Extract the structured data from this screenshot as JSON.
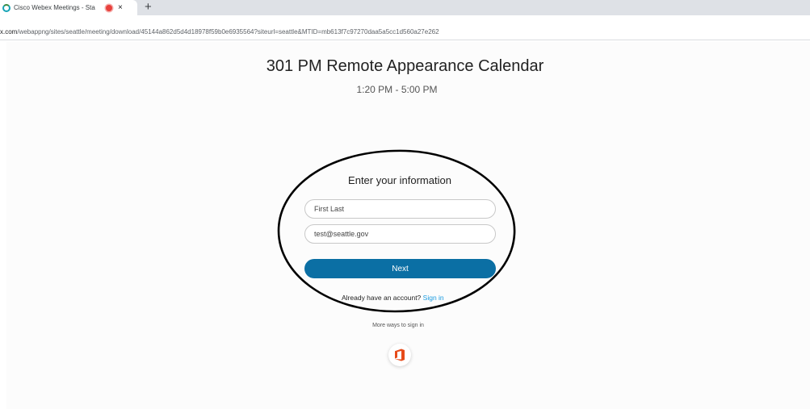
{
  "browser": {
    "tab": {
      "title": "Cisco Webex Meetings - Sta",
      "icon": "webex-favicon",
      "recording_indicator_color": "#e8413d",
      "close_label": "×"
    },
    "new_tab_label": "+",
    "url_prefix": "x.com",
    "url_path": "/webappng/sites/seattle/meeting/download/45144a862d5d4d18978f59b0e6935564?siteurl=seattle&MTID=mb613f7c97270daa5a5cc1d560a27e262"
  },
  "meeting": {
    "title": "301 PM Remote Appearance Calendar",
    "time": "1:20 PM - 5:00 PM"
  },
  "form": {
    "heading": "Enter your information",
    "name_value": "First Last",
    "email_value": "test@seattle.gov",
    "next_label": "Next",
    "account_prompt": "Already have an account?",
    "signin_label": "Sign in",
    "more_ways_label": "More ways to sign in"
  },
  "colors": {
    "accent": "#0b6fa4",
    "link": "#1a9be0",
    "office_brand": "#e64a19"
  },
  "annotation": {
    "shape": "hand-drawn-ellipse",
    "color": "#000000"
  }
}
